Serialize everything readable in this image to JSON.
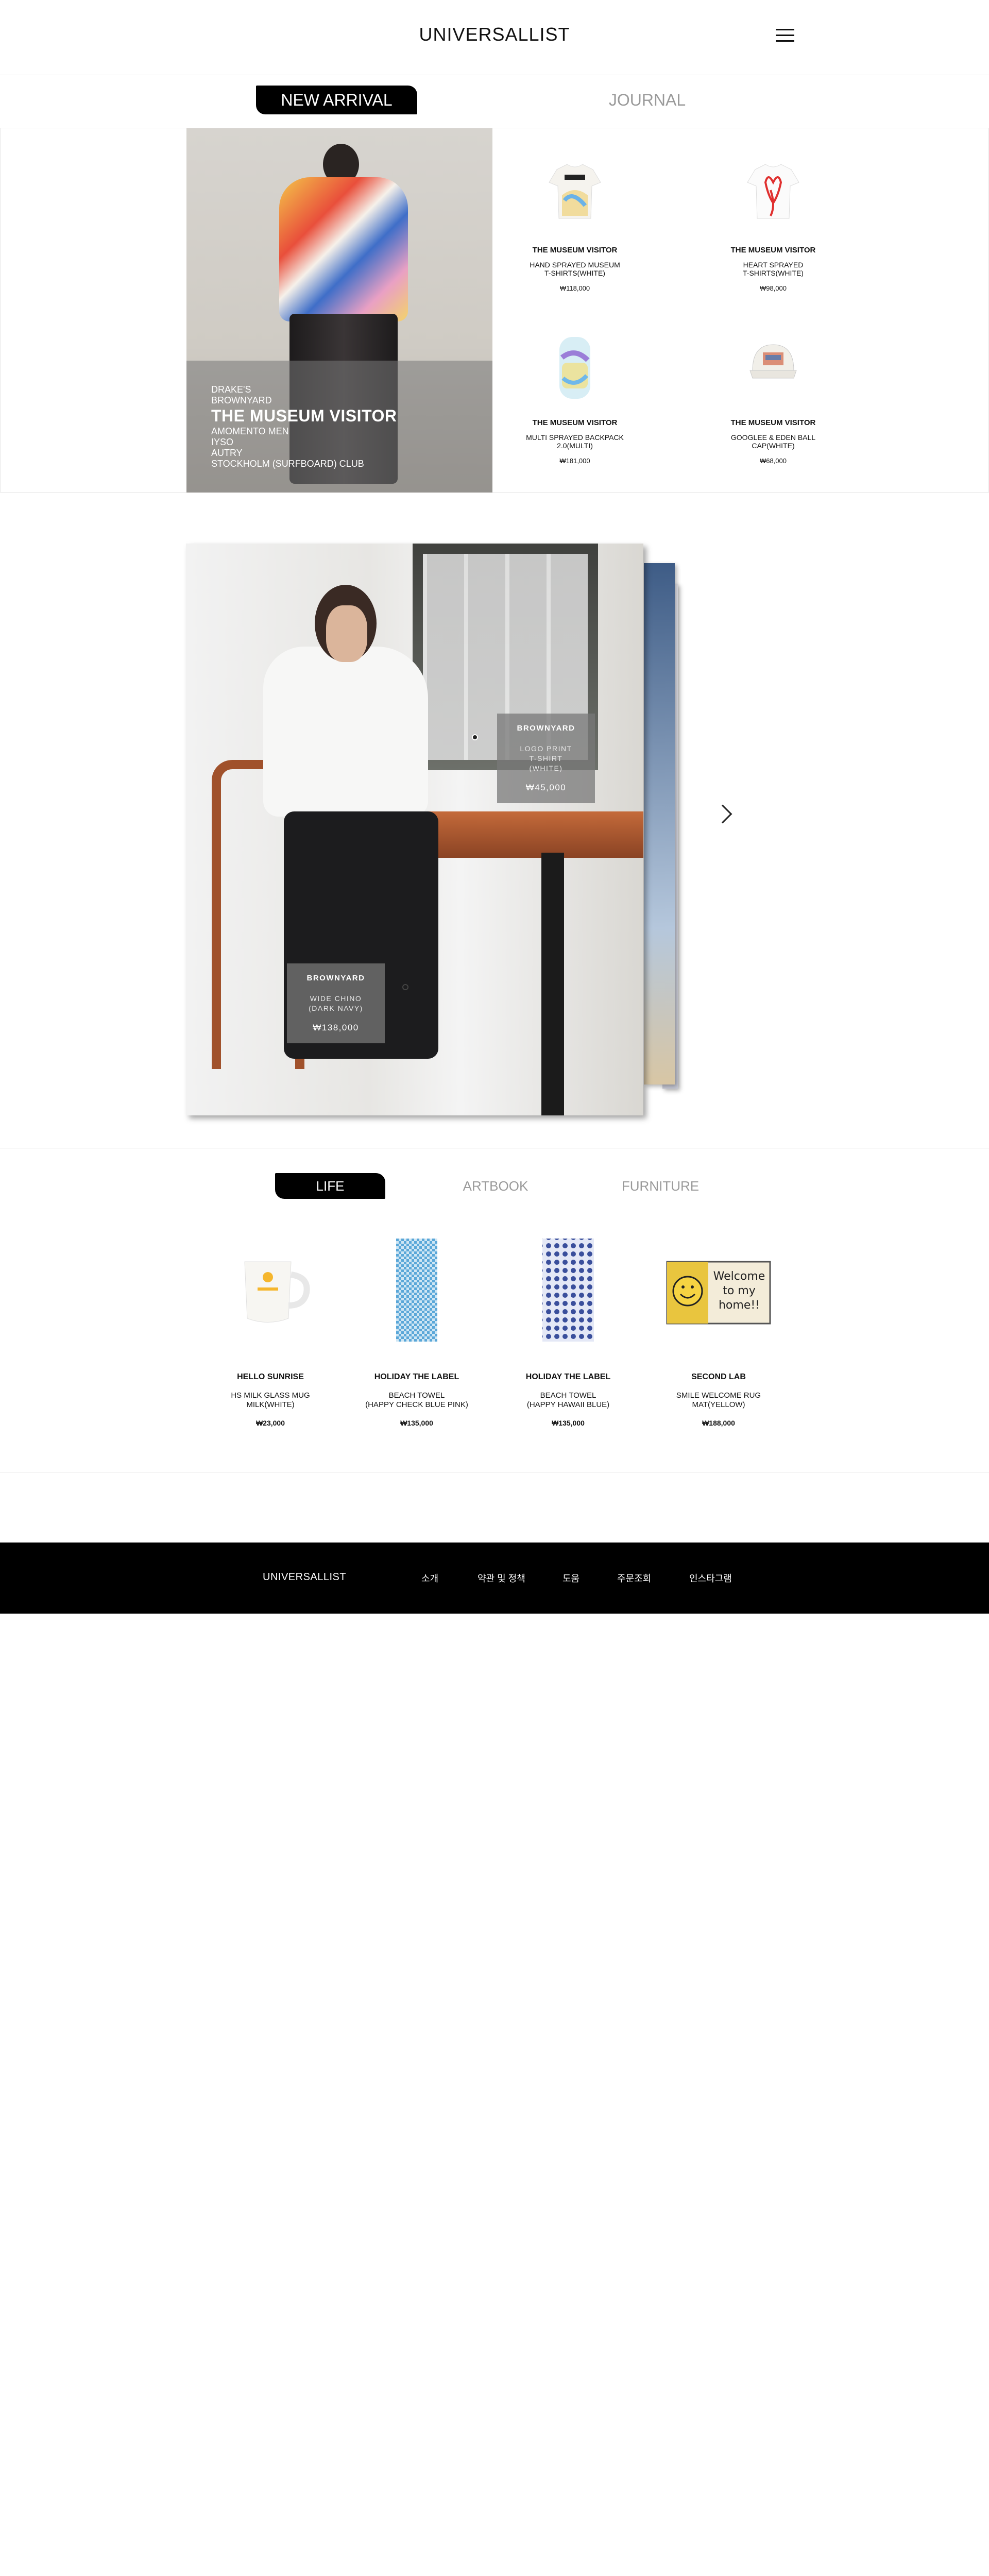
{
  "header": {
    "logo": "UNIVERSALLIST"
  },
  "tabs_top": [
    {
      "label": "NEW ARRIVAL",
      "active": true
    },
    {
      "label": "JOURNAL",
      "active": false
    }
  ],
  "hero": {
    "brand_lines": [
      "DRAKE'S",
      "BROWNYARD"
    ],
    "title": "THE MUSEUM VISITOR",
    "more_brands": [
      "AMOMENTO MEN",
      "IYSO",
      "AUTRY",
      "STOCKHOLM (SURFBOARD) CLUB"
    ]
  },
  "new_arrivals": [
    {
      "brand": "THE MUSEUM VISITOR",
      "name_lines": [
        "HAND SPRAYED MUSEUM",
        "T-SHIRTS(WHITE)"
      ],
      "price": "₩118,000"
    },
    {
      "brand": "THE MUSEUM VISITOR",
      "name_lines": [
        "HEART SPRAYED",
        "T-SHIRTS(WHITE)"
      ],
      "price": "₩98,000"
    },
    {
      "brand": "THE MUSEUM VISITOR",
      "name_lines": [
        "MULTI SPRAYED BACKPACK",
        "2.0(MULTI)"
      ],
      "price": "₩181,000"
    },
    {
      "brand": "THE MUSEUM VISITOR",
      "name_lines": [
        "GOOGLEE & EDEN BALL",
        "CAP(WHITE)"
      ],
      "price": "₩68,000"
    }
  ],
  "lookbook": {
    "tags": [
      {
        "brand": "BROWNYARD",
        "name_lines": [
          "LOGO PRINT",
          "T-SHIRT",
          "(WHITE)"
        ],
        "price": "₩45,000"
      },
      {
        "brand": "BROWNYARD",
        "name_lines": [
          "WIDE CHINO",
          "(DARK NAVY)"
        ],
        "price": "₩138,000"
      }
    ]
  },
  "tabs_bottom": [
    {
      "label": "LIFE",
      "active": true
    },
    {
      "label": "ARTBOOK",
      "active": false
    },
    {
      "label": "FURNITURE",
      "active": false
    }
  ],
  "life_products": [
    {
      "brand": "HELLO SUNRISE",
      "name_lines": [
        "HS MILK GLASS MUG",
        "MILK(WHITE)"
      ],
      "price": "₩23,000"
    },
    {
      "brand": "HOLIDAY THE LABEL",
      "name_lines": [
        "BEACH TOWEL",
        "(HAPPY CHECK BLUE PINK)"
      ],
      "price": "₩135,000"
    },
    {
      "brand": "HOLIDAY THE LABEL",
      "name_lines": [
        "BEACH TOWEL",
        "(HAPPY HAWAII BLUE)"
      ],
      "price": "₩135,000"
    },
    {
      "brand": "SECOND LAB",
      "name_lines": [
        "SMILE WELCOME RUG",
        "MAT(YELLOW)"
      ],
      "price": "₩188,000",
      "rug_text": [
        "Welcome",
        "to my",
        "home!!"
      ]
    }
  ],
  "footer": {
    "logo": "UNIVERSALLIST",
    "links": [
      "소개",
      "약관 및 정책",
      "도움",
      "주문조회",
      "인스타그램"
    ]
  }
}
